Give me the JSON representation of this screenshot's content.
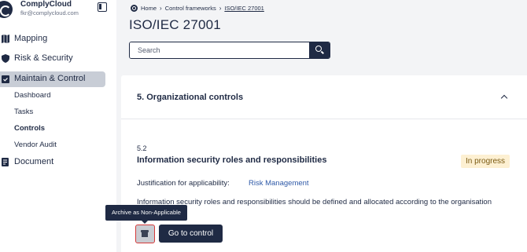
{
  "brand": {
    "name": "ComplyCloud",
    "email": "fkr@complycloud.com"
  },
  "sidebar": {
    "items": [
      {
        "label": "Mapping",
        "icon": "map-icon"
      },
      {
        "label": "Risk & Security",
        "icon": "shield-icon"
      },
      {
        "label": "Maintain & Control",
        "icon": "calendar-check-icon",
        "active": true
      },
      {
        "label": "Document",
        "icon": "document-icon"
      }
    ],
    "subitems": [
      {
        "label": "Dashboard"
      },
      {
        "label": "Tasks"
      },
      {
        "label": "Controls",
        "active": true
      },
      {
        "label": "Vendor Audit"
      }
    ]
  },
  "breadcrumb": {
    "home": "Home",
    "frameworks": "Control frameworks",
    "current": "ISO/IEC 27001"
  },
  "page": {
    "title": "ISO/IEC 27001"
  },
  "search": {
    "placeholder": "Search"
  },
  "section": {
    "title": "5. Organizational controls"
  },
  "control": {
    "number": "5.2",
    "title": "Information security roles and responsibilities",
    "status": "In progress",
    "justification_label": "Justification for applicability:",
    "justification_value": "Risk Management",
    "description": "Information security roles and responsibilities should be defined and allocated according to the organisation needs."
  },
  "tooltip": {
    "text": "Archive as Non-Applicable"
  },
  "actions": {
    "goto_label": "Go to control"
  },
  "colors": {
    "primary": "#1f2a44",
    "active_nav_bg": "#c8cdd6",
    "status_bg": "#fdf0d2",
    "link": "#2f5aa8",
    "highlight_border": "#d43a3a"
  }
}
